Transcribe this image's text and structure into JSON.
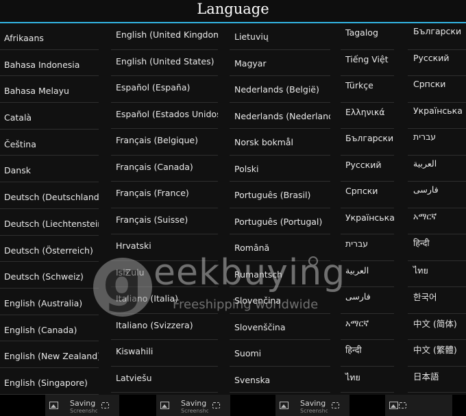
{
  "header": {
    "title": "Language"
  },
  "columns": [
    [
      "Afrikaans",
      "Bahasa Indonesia",
      "Bahasa Melayu",
      "Català",
      "Čeština",
      "Dansk",
      "Deutsch (Deutschland)",
      "Deutsch (Liechtenstein)",
      "Deutsch (Österreich)",
      "Deutsch (Schweiz)",
      "English (Australia)",
      "English (Canada)",
      "English (New Zealand)",
      "English (Singapore)"
    ],
    [
      "English (United Kingdom)",
      "English (United States)",
      "Español (España)",
      "Español (Estados Unidos)",
      "Français (Belgique)",
      "Français (Canada)",
      "Français (France)",
      "Français (Suisse)",
      "Hrvatski",
      "IsiZulu",
      "Italiano (Italia)",
      "Italiano (Svizzera)",
      "Kiswahili",
      "Latviešu"
    ],
    [
      "Lietuvių",
      "Magyar",
      "Nederlands (België)",
      "Nederlands (Nederland)",
      "Norsk bokmål",
      "Polski",
      "Português (Brasil)",
      "Português (Portugal)",
      "Română",
      "Rumantsch",
      "Slovenčina",
      "Slovenščina",
      "Suomi",
      "Svenska"
    ],
    [
      "Tagalog",
      "Tiếng Việt",
      "Türkçe",
      "Ελληνικά",
      "Български",
      "Русский",
      "Српски",
      "Українська",
      "עברית",
      "العربية",
      "فارسی",
      "አማርኛ",
      "हिन्दी",
      "ไทย"
    ],
    [
      "Български",
      "Русский",
      "Српски",
      "Українська",
      "עברית",
      "العربية",
      "فارسی",
      "አማርኛ",
      "हिन्दी",
      "ไทย",
      "한국어",
      "中文 (简体)",
      "中文 (繁體)",
      "日本語"
    ]
  ],
  "watermark": {
    "brand": "eekbuying",
    "tagline": "Freeshipping worldwide"
  },
  "notifications": [
    {
      "title": "Saving s",
      "subtitle": "Screenshot"
    },
    {
      "title": "Saving scr",
      "subtitle": "Screenshot is"
    },
    {
      "title": "Saving scr",
      "subtitle": "Screenshot"
    },
    {
      "title": "",
      "subtitle": ""
    }
  ]
}
